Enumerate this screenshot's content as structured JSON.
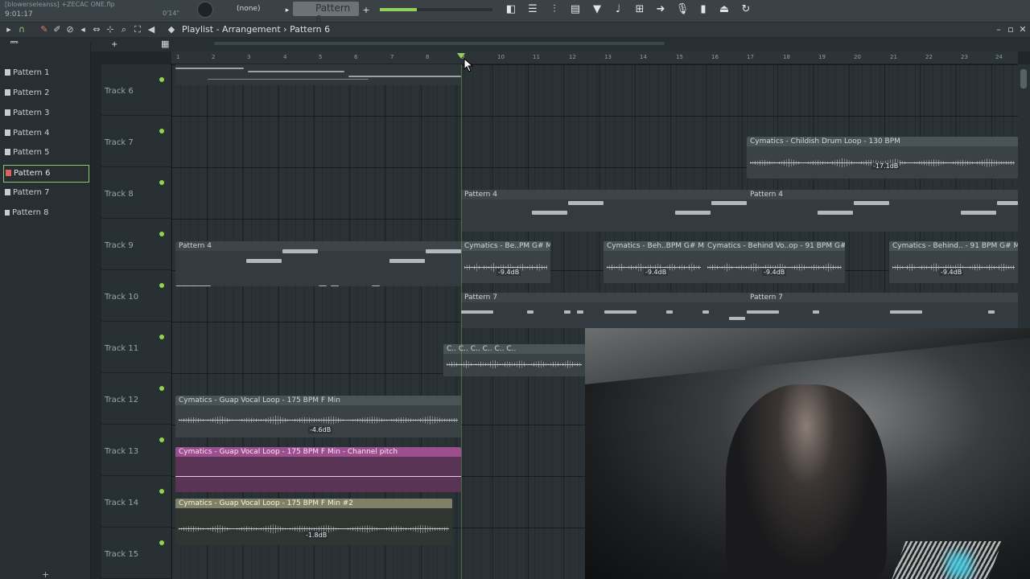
{
  "topbar": {
    "file_title": "[blowerseleanss] +ZECAC ONE.flp",
    "time": "9:01:17",
    "time_small": "0'14\"",
    "channel_select": "(none)",
    "pattern_select": "Pattern 6"
  },
  "toolbar2": {
    "breadcrumb_playlist": "Playlist - Arrangement",
    "breadcrumb_sep": "›",
    "breadcrumb_pattern": "Pattern 6"
  },
  "picker": {
    "items": [
      {
        "label": "Pattern 1"
      },
      {
        "label": "Pattern 2"
      },
      {
        "label": "Pattern 3"
      },
      {
        "label": "Pattern 4"
      },
      {
        "label": "Pattern 5"
      },
      {
        "label": "Pattern 6"
      },
      {
        "label": "Pattern 7"
      },
      {
        "label": "Pattern 8"
      }
    ],
    "selected": "Pattern 6"
  },
  "ruler": {
    "bars": [
      "1",
      "2",
      "3",
      "4",
      "5",
      "6",
      "7",
      "8",
      "9",
      "10",
      "11",
      "12",
      "13",
      "14",
      "15",
      "16",
      "17",
      "18",
      "19",
      "20",
      "21",
      "22",
      "23",
      "24"
    ]
  },
  "tracks": [
    "Track 6",
    "Track 7",
    "Track 8",
    "Track 9",
    "Track 10",
    "Track 11",
    "Track 12",
    "Track 13",
    "Track 14",
    "Track 15"
  ],
  "clips": {
    "t7_drum": {
      "title": "Cymatics - Childish Drum Loop - 130 BPM",
      "db": "-17.1dB"
    },
    "t8_a": {
      "title": "Pattern 4"
    },
    "t8_b": {
      "title": "Pattern 4"
    },
    "t9_pat": {
      "title": "Pattern 4"
    },
    "t9_a": {
      "title": "Cymatics - Be..PM G# Min",
      "db": "-9.4dB"
    },
    "t9_b": {
      "title": "Cymatics - Beh..BPM G# Min",
      "db": "-9.4dB"
    },
    "t9_c": {
      "title": "Cymatics - Behind Vo..op - 91 BPM G# Min",
      "db": "-9.4dB"
    },
    "t9_d": {
      "title": "Cymatics - Behind.. - 91 BPM G# Min",
      "db": "-9.4dB"
    },
    "t10_a": {
      "title": "Pattern 7"
    },
    "t10_b": {
      "title": "Pattern 7"
    },
    "t11": {
      "title": "C.. C.. C.. C.. C.. C.."
    },
    "t12": {
      "title": "Cymatics - Guap Vocal Loop - 175 BPM F Min",
      "db": "-4.6dB"
    },
    "t13": {
      "title": "Cymatics - Guap Vocal Loop - 175 BPM F Min - Channel pitch"
    },
    "t14": {
      "title": "Cymatics - Guap Vocal Loop - 175 BPM F Min #2",
      "db": "-1.8dB"
    }
  },
  "colors": {
    "accent_green": "#8fd15a",
    "automation": "#9c4f8f",
    "clip_green": "#7f8066"
  }
}
